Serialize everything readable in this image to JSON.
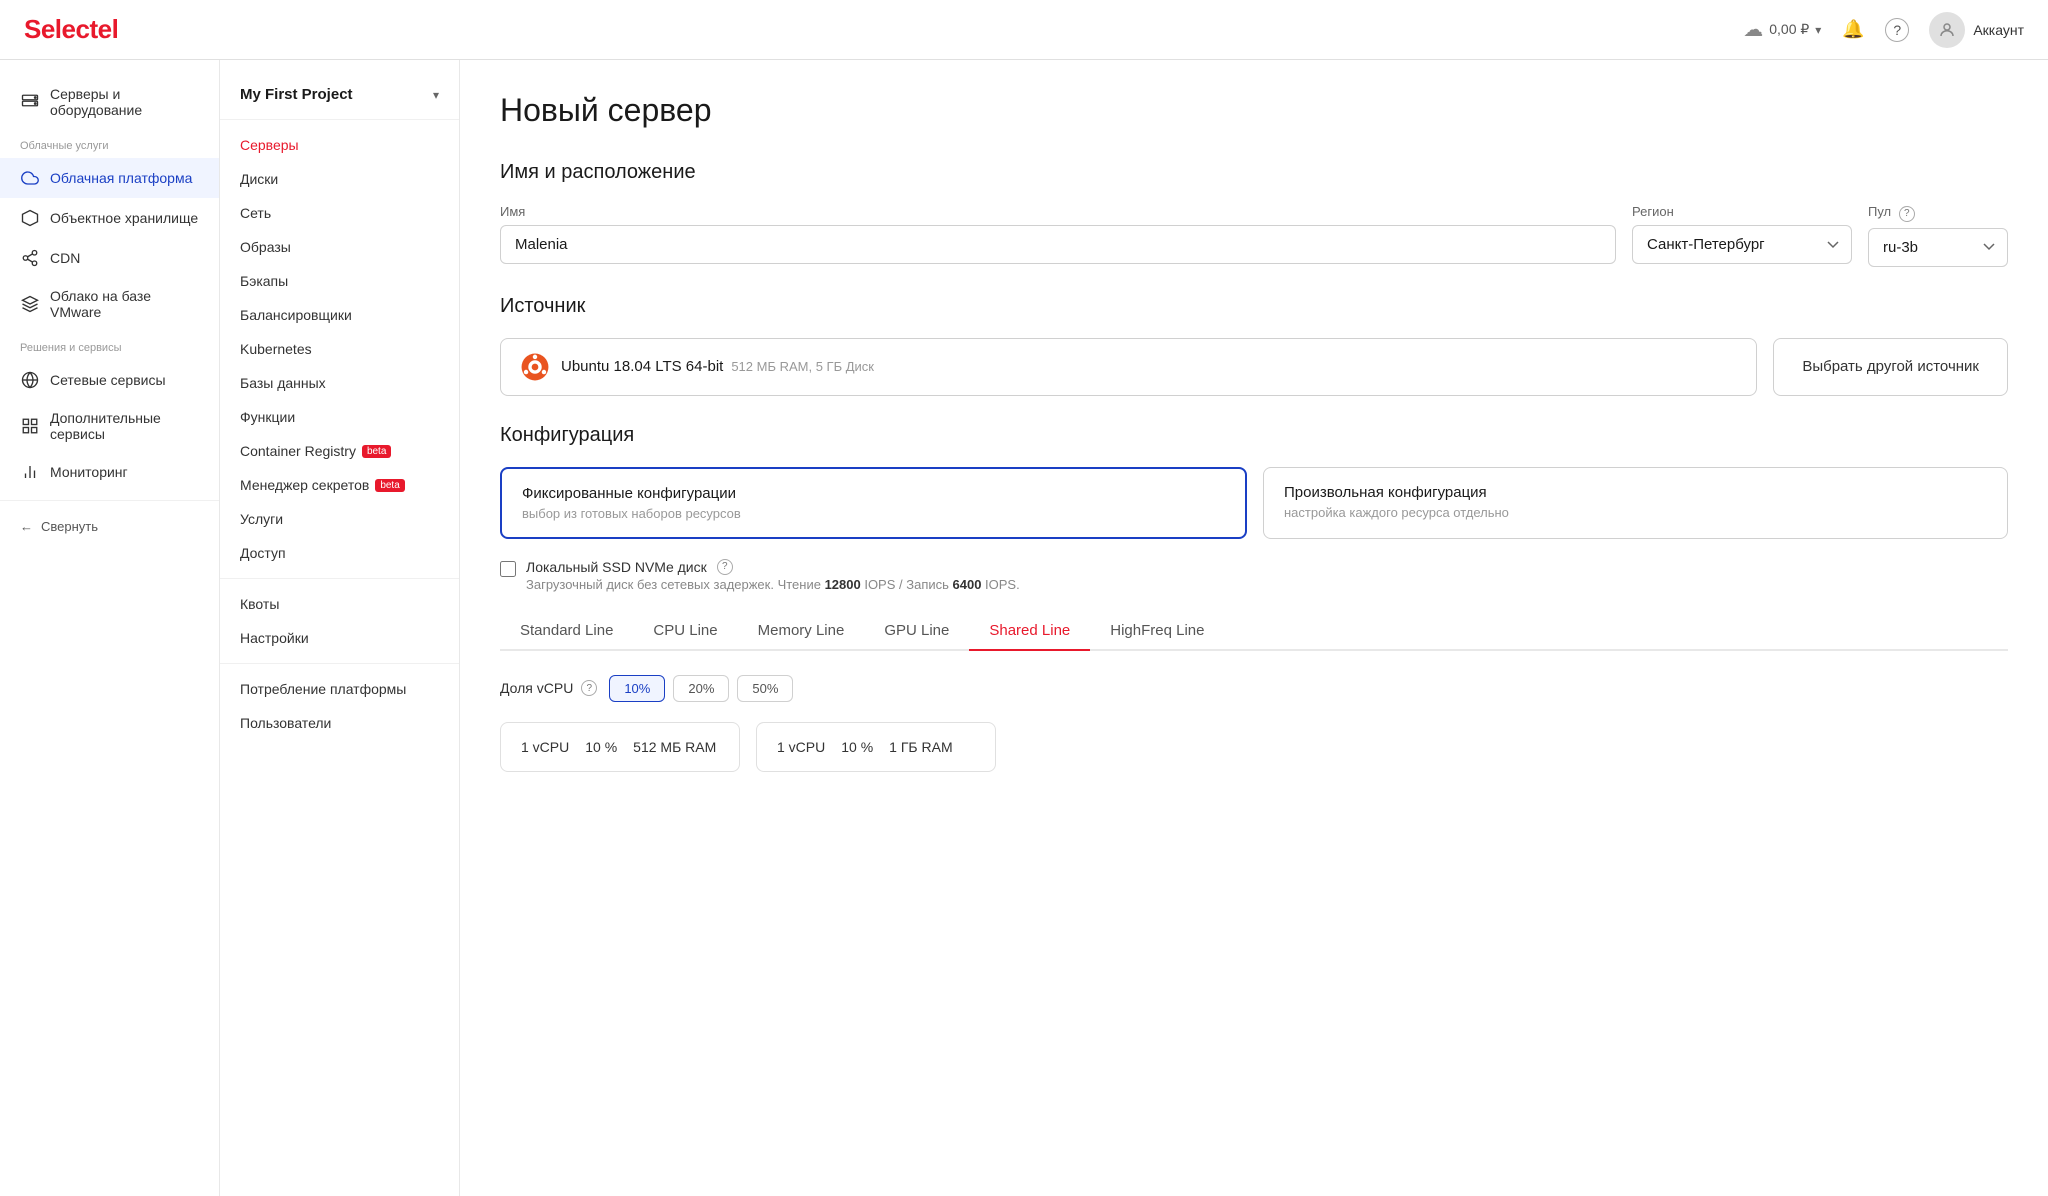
{
  "header": {
    "logo_prefix": "Select",
    "logo_highlight": "el",
    "balance": "0,00 ₽",
    "account_label": "Аккаунт"
  },
  "sidebar_left": {
    "sections": [
      {
        "items": [
          {
            "id": "servers-hardware",
            "label": "Серверы и оборудование",
            "icon": "server"
          }
        ]
      },
      {
        "label": "Облачные услуги",
        "items": [
          {
            "id": "cloud-platform",
            "label": "Облачная платформа",
            "icon": "cloud",
            "active": true
          },
          {
            "id": "object-storage",
            "label": "Объектное хранилище",
            "icon": "hexagon"
          },
          {
            "id": "cdn",
            "label": "CDN",
            "icon": "share"
          },
          {
            "id": "vmware",
            "label": "Облако на базе VMware",
            "icon": "layers"
          }
        ]
      },
      {
        "label": "Решения и сервисы",
        "items": [
          {
            "id": "network-services",
            "label": "Сетевые сервисы",
            "icon": "globe"
          },
          {
            "id": "extra-services",
            "label": "Дополнительные сервисы",
            "icon": "grid"
          },
          {
            "id": "monitoring",
            "label": "Мониторинг",
            "icon": "bar-chart"
          }
        ]
      }
    ],
    "collapse_label": "Свернуть"
  },
  "sidebar_second": {
    "project_name": "My First Project",
    "nav_items": [
      {
        "id": "servers",
        "label": "Серверы",
        "active": true
      },
      {
        "id": "disks",
        "label": "Диски"
      },
      {
        "id": "network",
        "label": "Сеть"
      },
      {
        "id": "images",
        "label": "Образы"
      },
      {
        "id": "backups",
        "label": "Бэкапы"
      },
      {
        "id": "balancers",
        "label": "Балансировщики"
      },
      {
        "id": "kubernetes",
        "label": "Kubernetes"
      },
      {
        "id": "databases",
        "label": "Базы данных"
      },
      {
        "id": "functions",
        "label": "Функции"
      },
      {
        "id": "container-registry",
        "label": "Container Registry",
        "badge": "beta"
      },
      {
        "id": "secrets-manager",
        "label": "Менеджер секретов",
        "badge": "beta"
      },
      {
        "id": "services",
        "label": "Услуги"
      },
      {
        "id": "access",
        "label": "Доступ"
      }
    ],
    "bottom_nav": [
      {
        "id": "quotas",
        "label": "Квоты"
      },
      {
        "id": "settings",
        "label": "Настройки"
      }
    ],
    "footer_nav": [
      {
        "id": "platform-usage",
        "label": "Потребление платформы"
      },
      {
        "id": "users",
        "label": "Пользователи"
      }
    ]
  },
  "main": {
    "page_title": "Новый сервер",
    "name_location_section": "Имя и расположение",
    "name_label": "Имя",
    "name_value": "Malenia",
    "region_label": "Регион",
    "region_value": "Санкт-Петербург",
    "pool_label": "Пул",
    "pool_value": "ru-3b",
    "source_section": "Источник",
    "source_name": "Ubuntu 18.04 LTS 64-bit",
    "source_meta": "512 МБ RAM, 5 ГБ Диск",
    "source_btn_label": "Выбрать другой источник",
    "config_section": "Конфигурация",
    "config_fixed_title": "Фиксированные конфигурации",
    "config_fixed_desc": "выбор из готовых наборов ресурсов",
    "config_custom_title": "Произвольная конфигурация",
    "config_custom_desc": "настройка каждого ресурса отдельно",
    "local_ssd_label": "Локальный SSD NVMe диск",
    "local_ssd_desc_prefix": "Загрузочный диск без сетевых задержек. Чтение ",
    "local_ssd_read_val": "12800",
    "local_ssd_desc_mid": " IOPS / Запись ",
    "local_ssd_write_val": "6400",
    "local_ssd_desc_suffix": " IOPS.",
    "tabs": [
      {
        "id": "standard",
        "label": "Standard Line"
      },
      {
        "id": "cpu",
        "label": "CPU Line"
      },
      {
        "id": "memory",
        "label": "Memory Line"
      },
      {
        "id": "gpu",
        "label": "GPU Line"
      },
      {
        "id": "shared",
        "label": "Shared Line",
        "active": true
      },
      {
        "id": "highfreq",
        "label": "HighFreq Line"
      }
    ],
    "vcpu_label": "Доля vCPU",
    "vcpu_options": [
      {
        "value": "10%",
        "active": true
      },
      {
        "value": "20%",
        "active": false
      },
      {
        "value": "50%",
        "active": false
      }
    ],
    "server_cards": [
      {
        "vcpu": "1 vCPU",
        "share": "10 %",
        "ram": "512 МБ RAM"
      },
      {
        "vcpu": "1 vCPU",
        "share": "10 %",
        "ram": "1 ГБ RAM"
      }
    ]
  }
}
